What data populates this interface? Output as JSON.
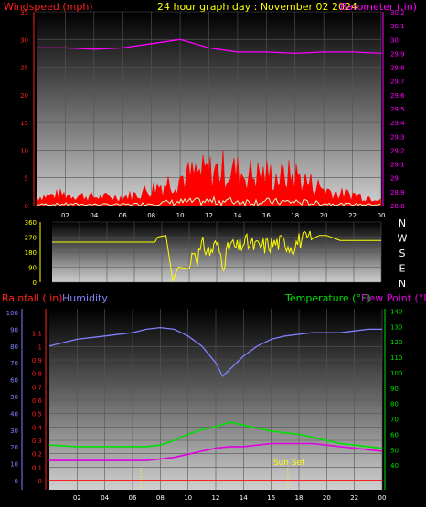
{
  "header": {
    "windspeed_label": "Windspeed (mph)",
    "title": "24 hour graph day : November 02 2024",
    "barometer_label": "Barometer (.in)"
  },
  "colors": {
    "wind_axis": "#ff2020",
    "baro_axis": "#ff00ff",
    "title": "#ffff00",
    "rain": "#ff2020",
    "humidity": "#8080ff",
    "temperature": "#00e000",
    "dewpoint": "#e000e0",
    "winddir": "#ffff00",
    "wind_avg": "#ff0000",
    "wind_gust": "#ffffff"
  },
  "lower_header": {
    "rainfall_label": "Rainfall (.in)",
    "humidity_label": "Humidity",
    "temperature_label": "Temperature (°F)",
    "dewpoint_label": "Dew Point (°F)"
  },
  "compass_labels": [
    "N",
    "W",
    "S",
    "E",
    "N"
  ],
  "annotation": "Sun Set",
  "chart_data": [
    {
      "type": "line",
      "title": "24 hour graph day : November 02 2024",
      "x_ticks": [
        "02",
        "04",
        "06",
        "08",
        "10",
        "12",
        "14",
        "16",
        "18",
        "20",
        "22",
        "00"
      ],
      "y_left": {
        "label": "Windspeed (mph)",
        "lim": [
          0,
          35
        ],
        "ticks": [
          "0",
          "5",
          "10",
          "15",
          "20",
          "25",
          "30",
          "35"
        ]
      },
      "y_right": {
        "label": "Barometer (.in)",
        "lim": [
          28.8,
          30.2
        ],
        "ticks": [
          "28.8",
          "28.9",
          "29",
          "29.1",
          "29.2",
          "29.3",
          "29.4",
          "29.5",
          "29.6",
          "29.7",
          "29.8",
          "29.9",
          "30",
          "30.1",
          "30.2"
        ]
      },
      "series": [
        {
          "name": "Windspeed (mph)",
          "hours": [
            0,
            2,
            4,
            6,
            7,
            8,
            9,
            10,
            11,
            12,
            13,
            14,
            15,
            16,
            17,
            18,
            19,
            20,
            21,
            22,
            23,
            24
          ],
          "values": [
            1.5,
            2,
            1.5,
            1.5,
            2,
            3,
            4,
            5,
            5.5,
            6,
            6.5,
            6,
            5.5,
            5.5,
            5,
            5.5,
            4,
            3,
            2,
            2,
            1.5,
            1.5
          ]
        },
        {
          "name": "Barometer (.in)",
          "hours": [
            0,
            2,
            4,
            6,
            8,
            10,
            11,
            12,
            14,
            16,
            18,
            20,
            22,
            24
          ],
          "values": [
            29.94,
            29.94,
            29.93,
            29.94,
            29.97,
            30.0,
            29.97,
            29.94,
            29.91,
            29.91,
            29.9,
            29.91,
            29.91,
            29.9
          ]
        }
      ]
    },
    {
      "type": "line",
      "y_left": {
        "lim": [
          0,
          360
        ],
        "ticks": [
          "0",
          "90",
          "180",
          "270",
          "360"
        ]
      },
      "series": [
        {
          "name": "Wind direction",
          "hours": [
            0,
            6,
            7.5,
            7.7,
            8.3,
            8.8,
            9.2,
            10,
            10.3,
            10.6,
            11,
            11.5,
            12,
            12.5,
            13,
            13.5,
            14,
            15,
            16,
            17,
            17.5,
            18,
            19,
            19.5,
            20,
            21,
            22,
            23,
            24
          ],
          "values": [
            240,
            240,
            240,
            270,
            280,
            10,
            90,
            80,
            200,
            150,
            220,
            180,
            230,
            120,
            230,
            200,
            240,
            210,
            230,
            240,
            210,
            250,
            260,
            280,
            280,
            250,
            250,
            250,
            250
          ]
        }
      ]
    },
    {
      "type": "line",
      "x_ticks": [
        "02",
        "04",
        "06",
        "08",
        "10",
        "12",
        "14",
        "16",
        "18",
        "20",
        "22",
        "00"
      ],
      "y_rain": {
        "label": "Rainfall (.in)",
        "lim": [
          0,
          1.2
        ],
        "ticks": [
          "0",
          "0.1",
          "0.2",
          "0.3",
          "0.4",
          "0.5",
          "0.6",
          "0.7",
          "0.8",
          "0.9",
          "1",
          "1.1"
        ]
      },
      "y_humidity": {
        "label": "Humidity",
        "lim": [
          0,
          100
        ],
        "ticks": [
          "0",
          "10",
          "20",
          "30",
          "40",
          "50",
          "60",
          "70",
          "80",
          "90",
          "100"
        ]
      },
      "y_temp": {
        "label": "Temperature (°F)",
        "lim": [
          30,
          145
        ],
        "ticks": [
          "40",
          "50",
          "60",
          "70",
          "80",
          "90",
          "100",
          "110",
          "120",
          "130",
          "140"
        ]
      },
      "annotations": [
        "Sun Set"
      ],
      "series": [
        {
          "name": "Humidity",
          "hours": [
            0,
            2,
            4,
            6,
            7,
            8,
            9,
            10,
            11,
            12,
            12.5,
            13,
            14,
            15,
            16,
            17,
            18,
            19,
            20,
            21,
            22,
            23,
            24
          ],
          "values": [
            80,
            84,
            86,
            88,
            90,
            91,
            90,
            86,
            80,
            70,
            62,
            66,
            74,
            80,
            84,
            86,
            87,
            88,
            88,
            88,
            89,
            90,
            90
          ]
        },
        {
          "name": "Temperature (°F)",
          "hours": [
            0,
            2,
            4,
            6,
            7,
            8,
            9,
            10,
            11,
            12,
            13,
            14,
            15,
            16,
            17,
            18,
            19,
            20,
            21,
            22,
            23,
            24
          ],
          "values": [
            53,
            52,
            52,
            52,
            52,
            53,
            56,
            60,
            63,
            65,
            68,
            66,
            64,
            62,
            61,
            60,
            58,
            56,
            54,
            53,
            52,
            51
          ]
        },
        {
          "name": "Dew Point (°F)",
          "hours": [
            0,
            2,
            4,
            6,
            7,
            8,
            9,
            10,
            11,
            12,
            13,
            14,
            15,
            16,
            17,
            18,
            19,
            20,
            21,
            22,
            23,
            24
          ],
          "values": [
            43,
            43,
            43,
            43,
            43,
            44,
            45,
            47,
            49,
            51,
            52,
            52,
            53,
            54,
            54,
            54,
            54,
            53,
            52,
            51,
            50,
            49
          ]
        },
        {
          "name": "Rainfall (.in)",
          "hours": [
            0,
            24
          ],
          "values": [
            0,
            0
          ]
        }
      ]
    }
  ]
}
